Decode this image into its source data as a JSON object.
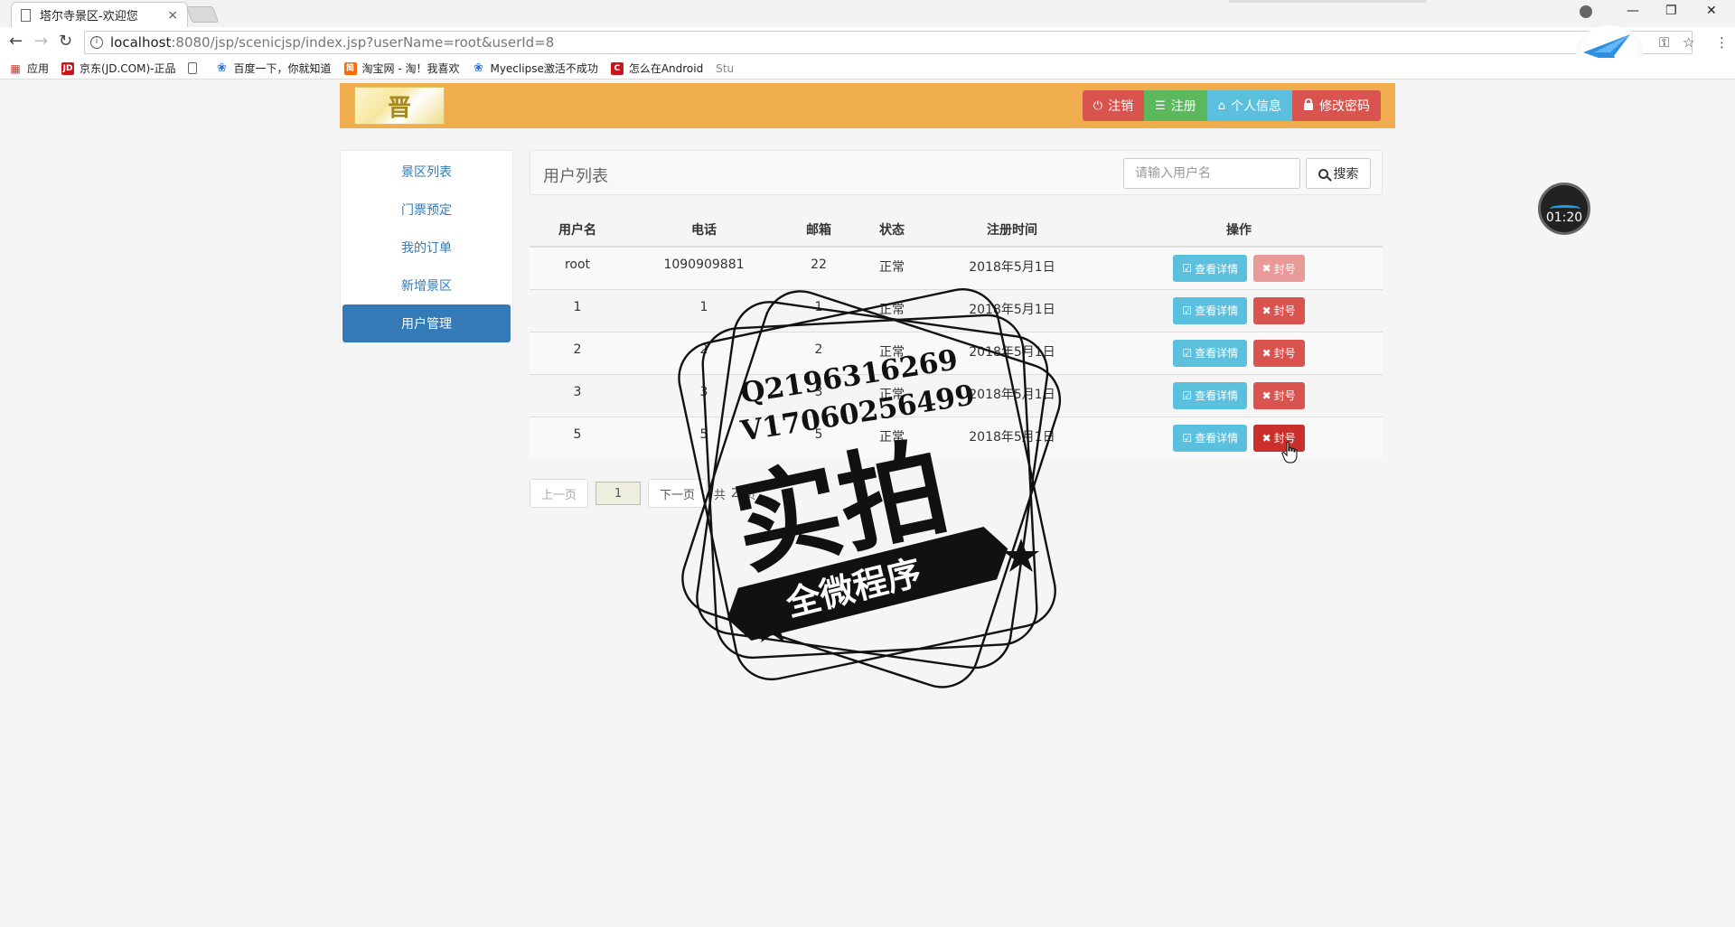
{
  "browser": {
    "tab_title": "塔尔寺景区-欢迎您",
    "tab_close": "×",
    "url_host": "localhost",
    "url_rest": ":8080/jsp/scenicjsp/index.jsp?userName=root&userId=8",
    "info_glyph": "i",
    "bookmarks": [
      {
        "label": "应用",
        "color": "#c0392b"
      },
      {
        "label": "京东(JD.COM)-正品",
        "color": "#c9151e"
      },
      {
        "label": "百度一下，你就知道",
        "color": "#2f6fd6"
      },
      {
        "label": "淘宝网 - 淘！我喜欢",
        "color": "#ff6a00"
      },
      {
        "label": "Myeclipse激活不成功",
        "color": "#2f6fd6"
      },
      {
        "label": "怎么在Android",
        "color": "#c9151e"
      },
      {
        "label": "Stu",
        "color": "#888888"
      }
    ],
    "bookmark_glyphs": [
      "JD",
      "简",
      "C"
    ]
  },
  "header": {
    "logo_text": "晋",
    "buttons": [
      {
        "label": "注销",
        "icon": "power-icon",
        "glyph": "⏻",
        "style": "red"
      },
      {
        "label": "注册",
        "icon": "list-icon",
        "glyph": "☰",
        "style": "green"
      },
      {
        "label": "个人信息",
        "icon": "home-icon",
        "glyph": "⌂",
        "style": "blue"
      },
      {
        "label": "修改密码",
        "icon": "lock-icon",
        "glyph": "🔒",
        "style": "red2"
      }
    ]
  },
  "sidebar": {
    "items": [
      {
        "label": "景区列表",
        "active": false
      },
      {
        "label": "门票预定",
        "active": false
      },
      {
        "label": "我的订单",
        "active": false
      },
      {
        "label": "新增景区",
        "active": false
      },
      {
        "label": "用户管理",
        "active": true
      }
    ]
  },
  "panel": {
    "title": "用户列表",
    "search_placeholder": "请输入用户名",
    "search_button": "搜索"
  },
  "table": {
    "headers": [
      "用户名",
      "电话",
      "邮箱",
      "状态",
      "注册时间",
      "操作"
    ],
    "view_label": "查看详情",
    "ban_label": "封号",
    "view_glyph": "☑",
    "ban_glyph": "✖",
    "rows": [
      {
        "username": "root",
        "phone": "1090909881",
        "email": "22",
        "status": "正常",
        "date": "2018年5月1日",
        "ban_state": "disabled"
      },
      {
        "username": "1",
        "phone": "1",
        "email": "1",
        "status": "正常",
        "date": "2018年5月1日",
        "ban_state": "normal"
      },
      {
        "username": "2",
        "phone": "2",
        "email": "2",
        "status": "正常",
        "date": "2018年5月1日",
        "ban_state": "normal"
      },
      {
        "username": "3",
        "phone": "3",
        "email": "3",
        "status": "正常",
        "date": "2018年5月1日",
        "ban_state": "normal"
      },
      {
        "username": "5",
        "phone": "5",
        "email": "5",
        "status": "正常",
        "date": "2018年5月1日",
        "ban_state": "hover"
      }
    ]
  },
  "pager": {
    "prev": "上一页",
    "current": "1",
    "next": "下一页",
    "total_prefix": "共",
    "total_pages": "2",
    "total_suffix": "页"
  },
  "overlay": {
    "timer": "01:20",
    "watermark_line1": "Q2196316269",
    "watermark_line2": "V17060256499",
    "watermark_main": "实拍",
    "watermark_banner": "全微程序"
  }
}
